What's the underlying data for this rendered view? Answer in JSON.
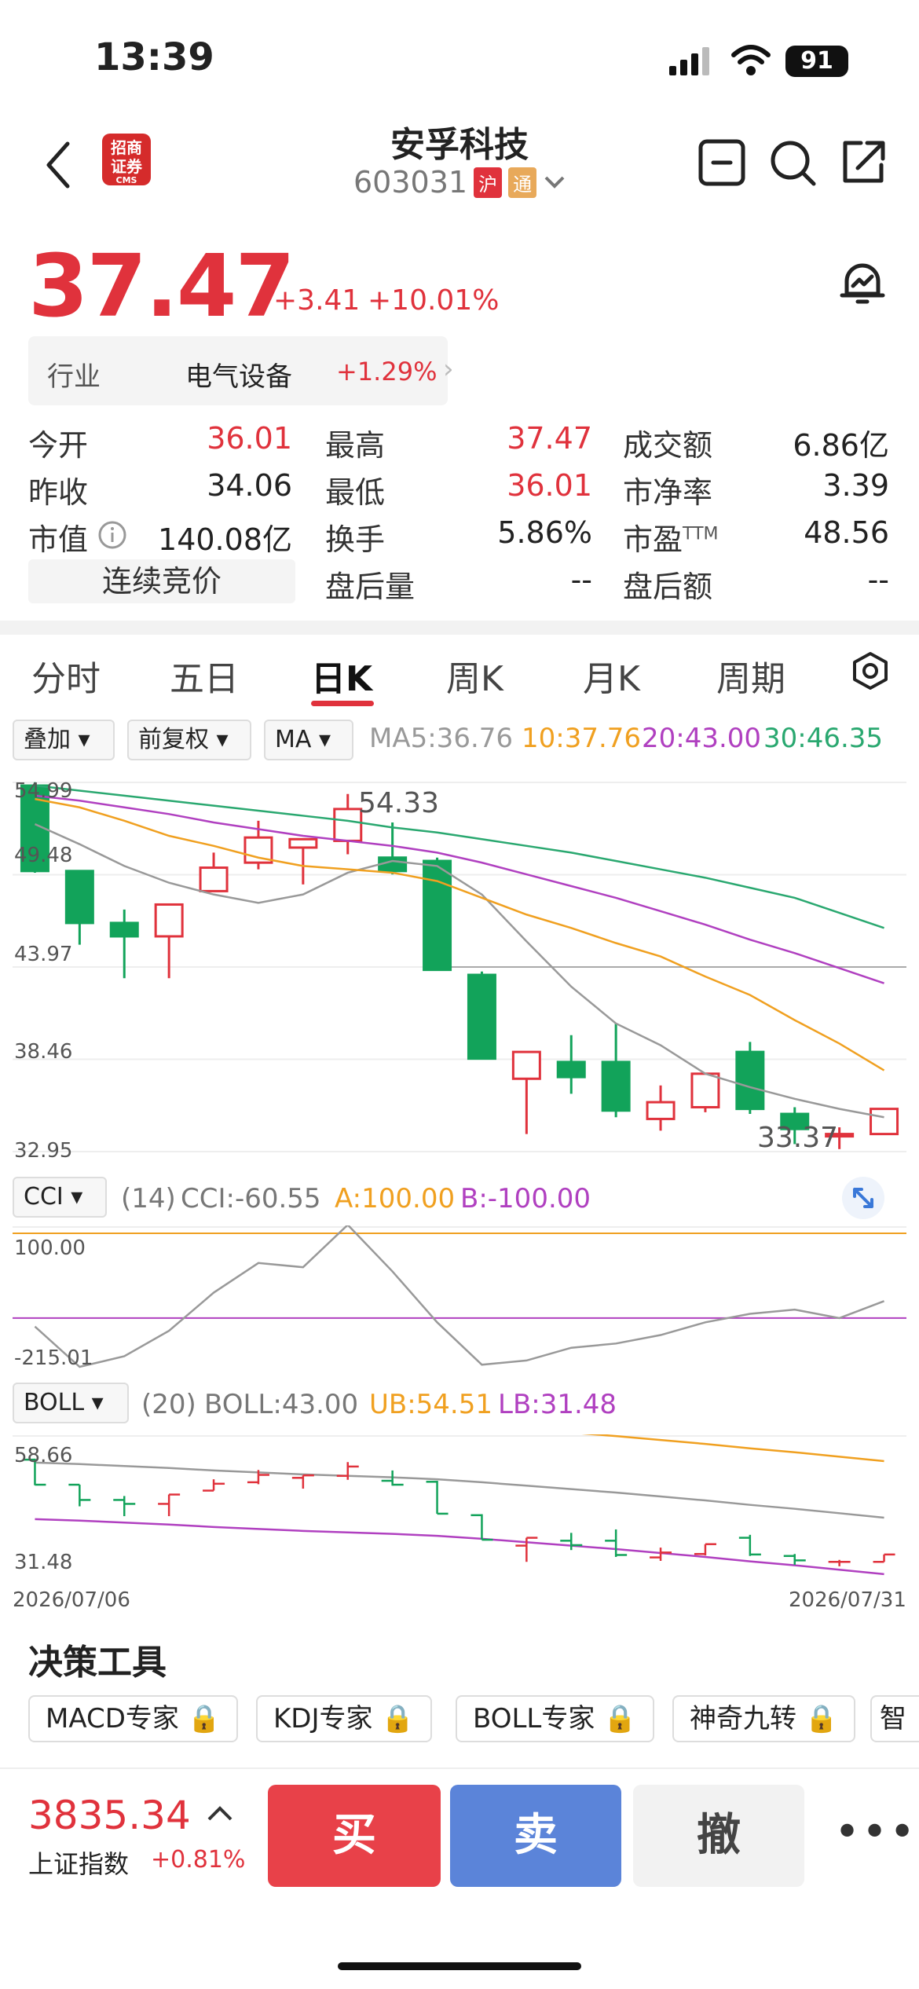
{
  "status": {
    "time": "13:39",
    "battery": "91"
  },
  "header": {
    "stock_name": "安孚科技",
    "stock_code": "603031",
    "tag_hu": "沪",
    "tag_tong": "通",
    "broker_logo": "招商证券",
    "broker_logo_sub": "CMS"
  },
  "quote": {
    "price": "37.47",
    "change": "+3.41",
    "change_pct": "+10.01%"
  },
  "industry": {
    "label": "行业",
    "value": "电气设备",
    "pct": "+1.29%"
  },
  "stats": {
    "open_label": "今开",
    "open": "36.01",
    "high_label": "最高",
    "high": "37.47",
    "amount_label": "成交额",
    "amount": "6.86亿",
    "prev_label": "昨收",
    "prev": "34.06",
    "low_label": "最低",
    "low": "36.01",
    "pb_label": "市净率",
    "pb": "3.39",
    "mcap_label": "市值",
    "mcap": "140.08亿",
    "turnover_label": "换手",
    "turnover": "5.86%",
    "pe_label": "市盈",
    "pe_sup": "TTM",
    "pe": "48.56",
    "auction_label": "连续竞价",
    "after_vol_label": "盘后量",
    "after_vol": "--",
    "after_amt_label": "盘后额",
    "after_amt": "--"
  },
  "tabs": [
    "分时",
    "五日",
    "日K",
    "周K",
    "月K",
    "周期"
  ],
  "active_tab": "日K",
  "chart_controls": {
    "overlay": "叠加",
    "adjust": "前复权",
    "indicator": "MA",
    "ma5": "MA5:36.76",
    "ma10": "10:37.76",
    "ma20": "20:43.00",
    "ma30": "30:46.35"
  },
  "kline_axis": {
    "y1": "54.99",
    "y2": "49.48",
    "y3": "43.97",
    "y4": "38.46",
    "y5": "32.95",
    "hi_label": "54.33",
    "lo_label": "33.37"
  },
  "cci": {
    "name": "CCI",
    "params": "(14)",
    "value": "CCI:-60.55",
    "a": "A:100.00",
    "b": "B:-100.00",
    "y_top": "100.00",
    "y_bottom": "-215.01"
  },
  "boll": {
    "name": "BOLL",
    "params": "(20)",
    "value": "BOLL:43.00",
    "ub": "UB:54.51",
    "lb": "LB:31.48",
    "y_top": "58.66",
    "y_bottom": "31.48"
  },
  "date_range": {
    "start": "2026/07/06",
    "end": "2026/07/31"
  },
  "decision": {
    "title": "决策工具",
    "tools": [
      "MACD专家",
      "KDJ专家",
      "BOLL专家",
      "神奇九转",
      "智"
    ]
  },
  "bottom": {
    "index_value": "3835.34",
    "index_name": "上证指数",
    "index_pct": "+0.81%",
    "buy": "买",
    "sell": "卖",
    "cancel": "撤",
    "more": "•••"
  },
  "colors": {
    "up": "#e0323c",
    "down": "#12a35a",
    "ma5": "#999999",
    "ma10": "#f0a020",
    "ma20": "#b040c0",
    "ma30": "#2aa870"
  },
  "chart_data": {
    "type": "candlestick",
    "ylim": [
      32.95,
      54.99
    ],
    "candles": [
      {
        "o": 54.8,
        "c": 49.7,
        "h": 55.0,
        "l": 49.6
      },
      {
        "o": 49.7,
        "c": 46.6,
        "h": 49.7,
        "l": 45.3
      },
      {
        "o": 46.6,
        "c": 45.8,
        "h": 47.4,
        "l": 43.3
      },
      {
        "o": 45.8,
        "c": 47.7,
        "h": 47.7,
        "l": 43.3
      },
      {
        "o": 48.5,
        "c": 49.9,
        "h": 50.8,
        "l": 48.5
      },
      {
        "o": 50.2,
        "c": 51.7,
        "h": 52.7,
        "l": 49.8
      },
      {
        "o": 51.1,
        "c": 51.6,
        "h": 51.6,
        "l": 48.9
      },
      {
        "o": 51.5,
        "c": 53.4,
        "h": 54.3,
        "l": 50.7
      },
      {
        "o": 50.5,
        "c": 49.7,
        "h": 52.6,
        "l": 49.5
      },
      {
        "o": 50.3,
        "c": 43.8,
        "h": 50.5,
        "l": 43.8
      },
      {
        "o": 43.5,
        "c": 38.5,
        "h": 43.7,
        "l": 38.5
      },
      {
        "o": 37.3,
        "c": 38.9,
        "h": 38.9,
        "l": 34.0
      },
      {
        "o": 38.3,
        "c": 37.4,
        "h": 39.9,
        "l": 36.4
      },
      {
        "o": 38.3,
        "c": 35.4,
        "h": 40.6,
        "l": 35.0
      },
      {
        "o": 34.9,
        "c": 35.9,
        "h": 36.9,
        "l": 34.2
      },
      {
        "o": 35.6,
        "c": 37.6,
        "h": 37.6,
        "l": 35.3
      },
      {
        "o": 38.9,
        "c": 35.5,
        "h": 39.5,
        "l": 35.2
      },
      {
        "o": 35.2,
        "c": 34.3,
        "h": 35.6,
        "l": 33.4
      },
      {
        "o": 34.0,
        "c": 34.0,
        "h": 34.4,
        "l": 33.1
      },
      {
        "o": 34.0,
        "c": 35.5,
        "h": 35.5,
        "l": 34.0
      }
    ],
    "ma5": [
      52.5,
      51.3,
      50.0,
      49.0,
      48.3,
      47.8,
      48.3,
      49.6,
      50.3,
      50.0,
      48.3,
      45.5,
      42.8,
      40.6,
      39.3,
      37.6,
      36.8,
      36.1,
      35.5,
      35.0
    ],
    "ma10": [
      54.0,
      53.5,
      52.7,
      51.8,
      51.2,
      50.5,
      50.0,
      49.8,
      49.6,
      49.1,
      48.1,
      47.1,
      46.3,
      45.4,
      44.6,
      43.4,
      42.3,
      40.8,
      39.4,
      37.8
    ],
    "ma20": [
      54.2,
      53.9,
      53.5,
      53.1,
      52.6,
      52.2,
      51.8,
      51.5,
      51.2,
      50.8,
      50.2,
      49.5,
      48.8,
      48.1,
      47.3,
      46.5,
      45.6,
      44.8,
      43.9,
      43.0
    ],
    "ma30": [
      54.8,
      54.5,
      54.2,
      53.9,
      53.6,
      53.3,
      53.0,
      52.7,
      52.3,
      52.0,
      51.6,
      51.2,
      50.8,
      50.3,
      49.8,
      49.3,
      48.7,
      48.1,
      47.2,
      46.3
    ],
    "cci": [
      -120,
      -215,
      -190,
      -130,
      -40,
      30,
      20,
      120,
      10,
      -110,
      -210,
      -200,
      -170,
      -160,
      -140,
      -110,
      -90,
      -80,
      -100,
      -60
    ]
  }
}
